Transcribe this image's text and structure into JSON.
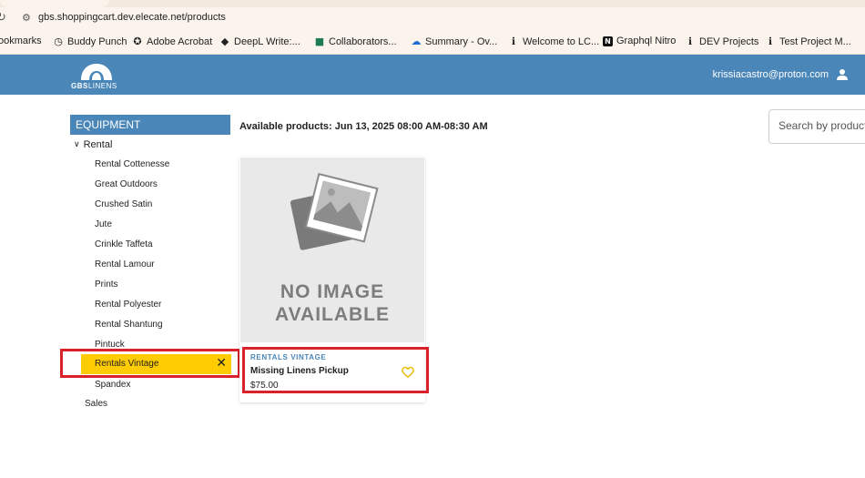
{
  "browser": {
    "url": "gbs.shoppingcart.dev.elecate.net/products",
    "bookmarks_label": "ookmarks",
    "bookmarks": [
      {
        "label": "Buddy Punch",
        "icon": "clock-icon"
      },
      {
        "label": "Adobe Acrobat",
        "icon": "acrobat-icon"
      },
      {
        "label": "DeepL Write:...",
        "icon": "deepl-icon"
      },
      {
        "label": "Collaborators...",
        "icon": "collaborators-icon"
      },
      {
        "label": "Summary - Ov...",
        "icon": "cloud-icon"
      },
      {
        "label": "Welcome to LC...",
        "icon": "info-icon"
      },
      {
        "label": "Graphql Nitro",
        "icon": "nitro-icon"
      },
      {
        "label": "DEV Projects",
        "icon": "info-icon"
      },
      {
        "label": "Test Project M...",
        "icon": "info-icon"
      }
    ]
  },
  "header": {
    "logo_bold": "GBS",
    "logo_light": "LINENS",
    "user_email": "krissiacastro@proton.com",
    "color": "#4a86b8"
  },
  "sidebar": {
    "heading": "EQUIPMENT",
    "parent": "Rental",
    "items": [
      "Rental Cottenesse",
      "Great Outdoors",
      "Crushed Satin",
      "Jute",
      "Crinkle Taffeta",
      "Rental Lamour",
      "Prints",
      "Rental Polyester",
      "Rental Shantung",
      "Pintuck"
    ],
    "selected": "Rentals Vintage",
    "after_selected": "Spandex",
    "sales": "Sales",
    "selected_color": "#fecc00"
  },
  "main": {
    "available": "Available products: Jun 13, 2025 08:00 AM-08:30 AM",
    "search_placeholder": "Search by product",
    "product": {
      "no_image_line1": "NO IMAGE",
      "no_image_line2": "AVAILABLE",
      "category": "RENTALS VINTAGE",
      "title": "Missing Linens Pickup",
      "price": "$75.00"
    }
  },
  "highlight_color": "#d9222a"
}
